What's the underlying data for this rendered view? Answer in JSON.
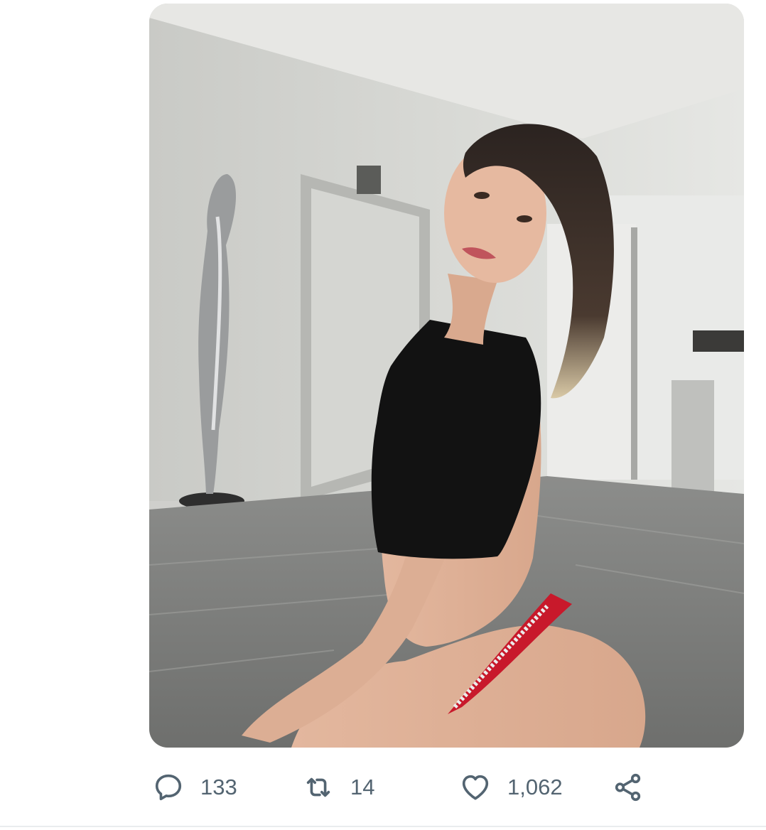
{
  "tweet": {
    "media": {
      "kind": "photo",
      "icon": "photo-image"
    },
    "actions": {
      "reply": {
        "icon": "speech-bubble-icon",
        "count": "133"
      },
      "retweet": {
        "icon": "retweet-arrows-icon",
        "count": "14"
      },
      "like": {
        "icon": "heart-icon",
        "count": "1,062"
      },
      "share": {
        "icon": "share-nodes-icon"
      }
    }
  },
  "colors": {
    "icon_gray": "#536471",
    "divider": "#e9ecee",
    "background": "#ffffff"
  }
}
